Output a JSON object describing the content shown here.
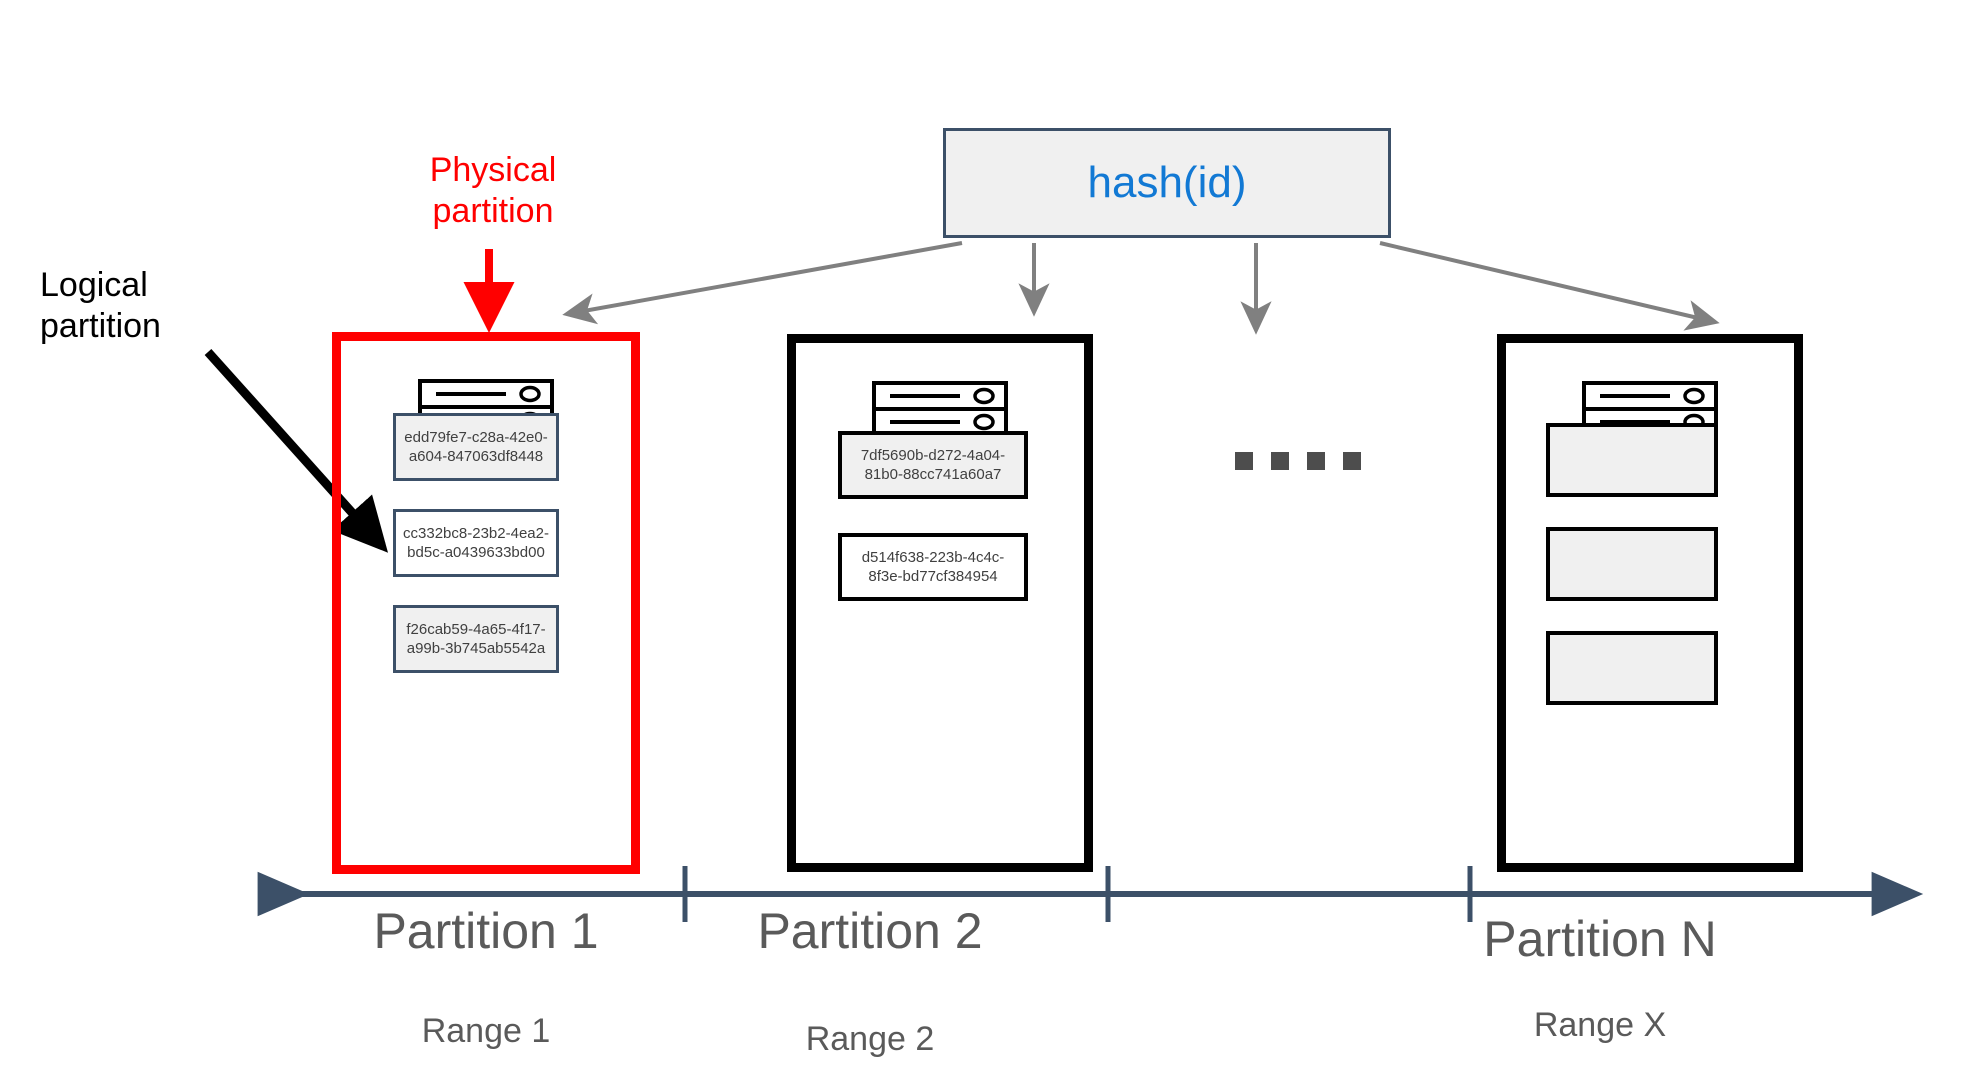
{
  "hash": {
    "label": "hash(id)",
    "text_color": "#1279d4",
    "border_color": "#3c5068",
    "fill_color": "#f0f0f0"
  },
  "callouts": {
    "physical": "Physical partition",
    "physical_color": "#ff0000",
    "logical": "Logical partition",
    "logical_color": "#000000"
  },
  "partitions": [
    {
      "id": "p1",
      "border_color": "#ff0000",
      "axis_label": "Partition 1",
      "range_label": "Range 1",
      "icon": "server-icon",
      "records": [
        {
          "id": "edd79fe7-c28a-42e0-a604-847063df8448",
          "filled": true
        },
        {
          "id": "cc332bc8-23b2-4ea2-bd5c-a0439633bd00",
          "filled": false
        },
        {
          "id": "f26cab59-4a65-4f17-a99b-3b745ab5542a",
          "filled": true
        }
      ]
    },
    {
      "id": "p2",
      "border_color": "#000000",
      "axis_label": "Partition 2",
      "range_label": "Range 2",
      "icon": "server-icon",
      "records": [
        {
          "id": "7df5690b-d272-4a04-81b0-88cc741a60a7",
          "filled": true
        },
        {
          "id": "d514f638-223b-4c4c-8f3e-bd77cf384954",
          "filled": false
        }
      ]
    },
    {
      "id": "pn",
      "border_color": "#000000",
      "axis_label": "Partition N",
      "range_label": "Range X",
      "icon": "server-icon",
      "records": [
        {
          "id": "",
          "filled": true
        },
        {
          "id": "",
          "filled": true
        },
        {
          "id": "",
          "filled": true
        }
      ]
    }
  ],
  "ellipsis": {
    "name": "ellipsis-dots",
    "count": 4,
    "color": "#4d4d4d"
  },
  "axis": {
    "color": "#3c5068",
    "left_arrow": true,
    "right_arrow": true,
    "tick_count": 3
  },
  "connectors": {
    "color": "#808080",
    "count": 4,
    "description": "hash-to-partition arrows"
  }
}
